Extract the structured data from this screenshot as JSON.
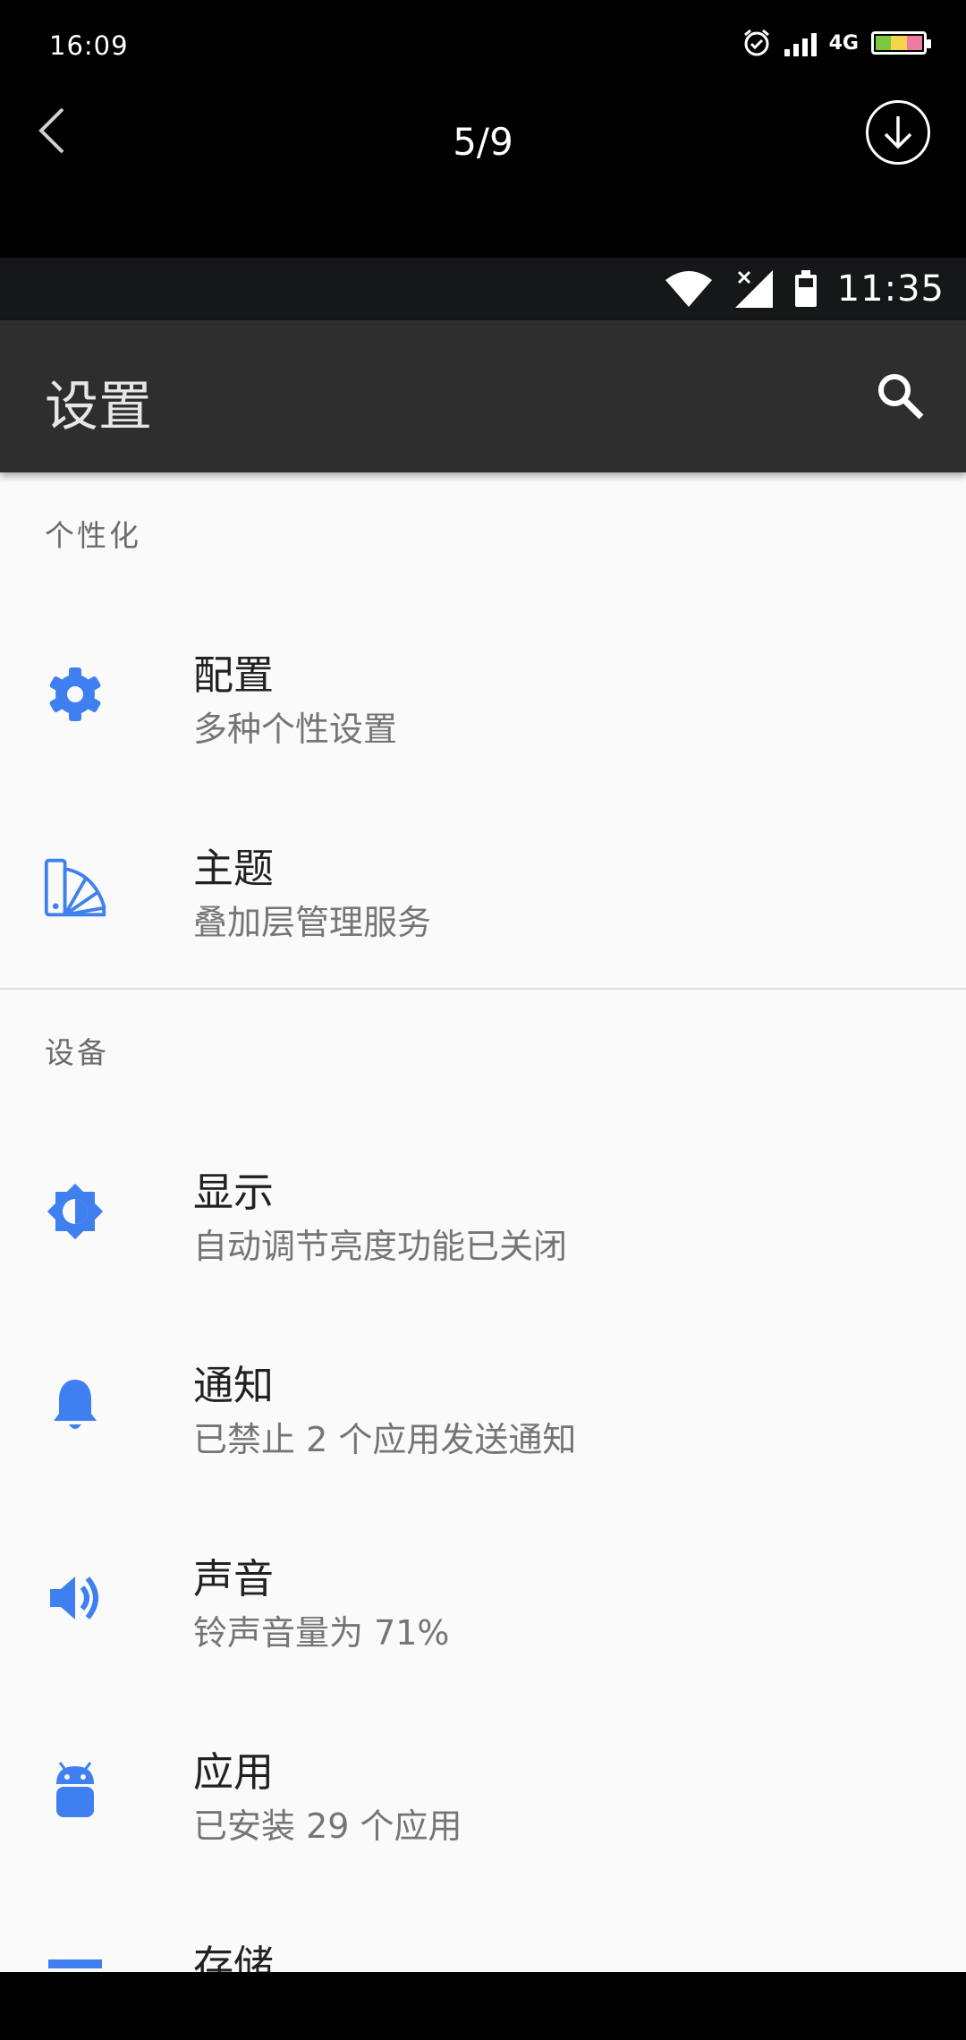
{
  "outer_status": {
    "time": "16:09",
    "network": "4G"
  },
  "viewer": {
    "page_counter": "5/9"
  },
  "inner_status": {
    "time": "11:35"
  },
  "appbar": {
    "title": "设置"
  },
  "sections": [
    {
      "header": "个性化",
      "items": [
        {
          "title": "配置",
          "subtitle": "多种个性设置",
          "icon": "gear-icon"
        },
        {
          "title": "主题",
          "subtitle": "叠加层管理服务",
          "icon": "palette-icon"
        }
      ]
    },
    {
      "header": "设备",
      "items": [
        {
          "title": "显示",
          "subtitle": "自动调节亮度功能已关闭",
          "icon": "brightness-icon"
        },
        {
          "title": "通知",
          "subtitle": "已禁止 2 个应用发送通知",
          "icon": "bell-icon"
        },
        {
          "title": "声音",
          "subtitle": "铃声音量为 71%",
          "icon": "volume-icon"
        },
        {
          "title": "应用",
          "subtitle": "已安装 29 个应用",
          "icon": "android-icon"
        },
        {
          "title": "存储",
          "subtitle": "",
          "icon": "storage-icon"
        }
      ]
    }
  ],
  "colors": {
    "accent": "#3f7fef",
    "appbar": "#2e2e2e",
    "background": "#fafafa"
  }
}
